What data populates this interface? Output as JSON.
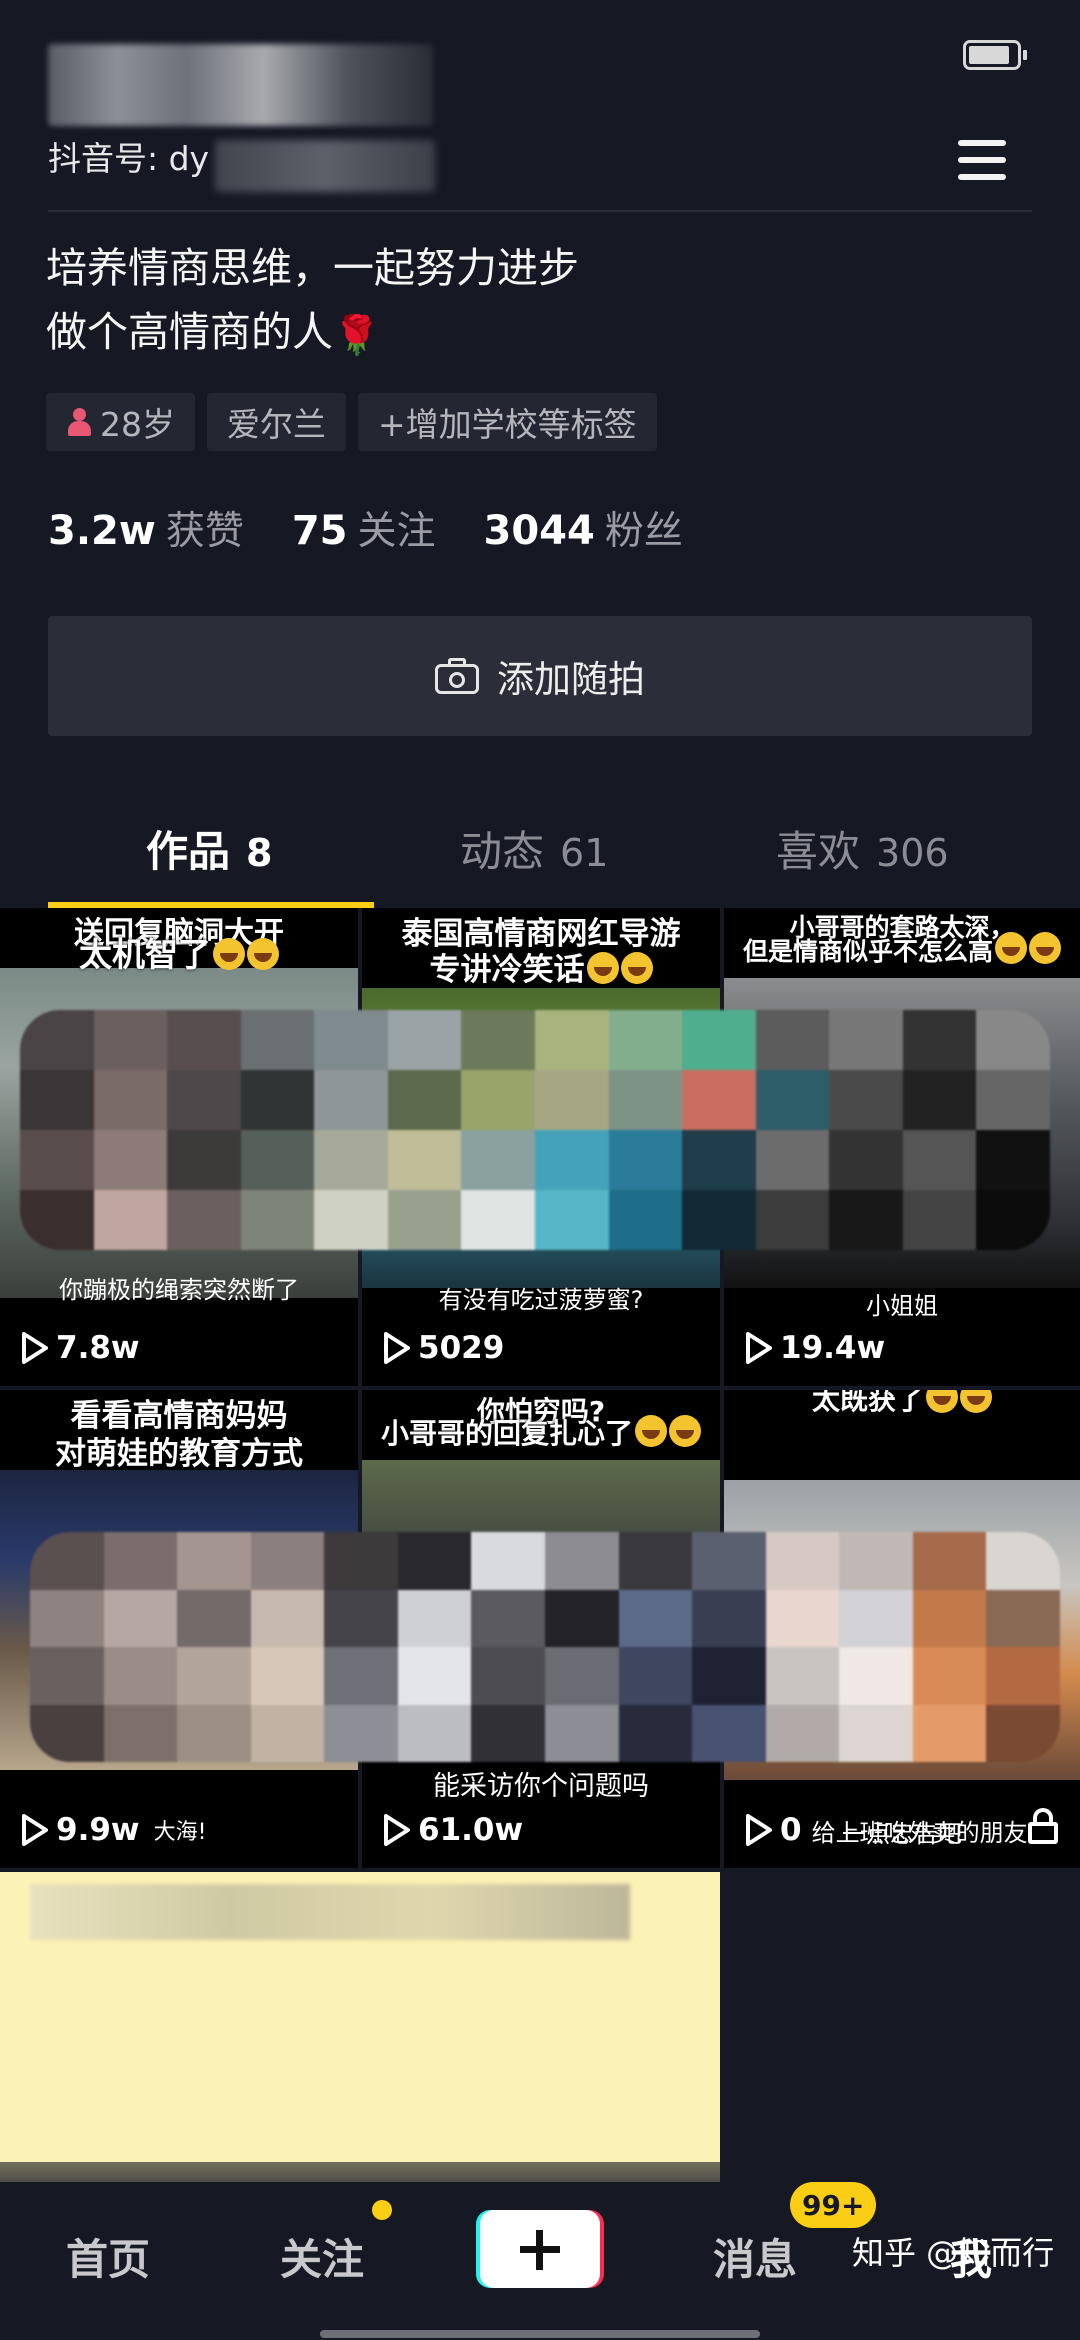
{
  "status": {
    "battery_icon": "battery-icon"
  },
  "profile": {
    "douyin_id_label": "抖音号: dy",
    "bio_line1": "培养情商思维，一起努力进步",
    "bio_line2": "做个高情商的人",
    "bio_emoji": "🌹",
    "tags": {
      "age": "28岁",
      "location": "爱尔兰",
      "add_tag": "+增加学校等标签"
    },
    "stats": {
      "likes_num": "3.2w",
      "likes_label": "获赞",
      "following_num": "75",
      "following_label": "关注",
      "fans_num": "3044",
      "fans_label": "粉丝"
    },
    "add_snap_label": "添加随拍"
  },
  "tabs": [
    {
      "label": "作品",
      "count": "8",
      "active": true
    },
    {
      "label": "动态",
      "count": "61",
      "active": false
    },
    {
      "label": "喜欢",
      "count": "306",
      "active": false
    }
  ],
  "videos": [
    {
      "top_caption_1": "送回复脑洞大开",
      "top_caption_2": "太机智了",
      "bottom_caption": "你蹦极的绳索突然断了",
      "views": "7.8w"
    },
    {
      "top_caption_1": "泰国高情商网红导游",
      "top_caption_2": "专讲冷笑话",
      "bottom_caption": "有没有吃过菠萝蜜?",
      "views": "5029"
    },
    {
      "top_caption_1": "小哥哥的套路太深，",
      "top_caption_2": "但是情商似乎不怎么高",
      "bottom_caption": "小姐姐",
      "views": "19.4w"
    },
    {
      "top_caption_1": "看看高情商妈妈",
      "top_caption_2": "对萌娃的教育方式",
      "bottom_caption": "大海!",
      "views": "9.9w"
    },
    {
      "top_caption_1": "你怕穷吗?",
      "top_caption_2": "小哥哥的回复扎心了",
      "bottom_caption": "能采访你个问题吗",
      "views": "61.0w"
    },
    {
      "top_caption_1": "太既获了",
      "top_caption_2": "",
      "bottom_caption": "给上班吃外卖的朋友",
      "bottom_caption_2": "一点忠告吧",
      "views": "0"
    }
  ],
  "bottom_nav": {
    "home": "首页",
    "following": "关注",
    "messages": "消息",
    "messages_badge": "99+",
    "me": "我"
  },
  "watermark": "知乎 @知而行",
  "colors": {
    "background": "#161823",
    "accent": "#face15",
    "plus_cyan": "#25f4ee",
    "plus_red": "#fe2c55"
  }
}
